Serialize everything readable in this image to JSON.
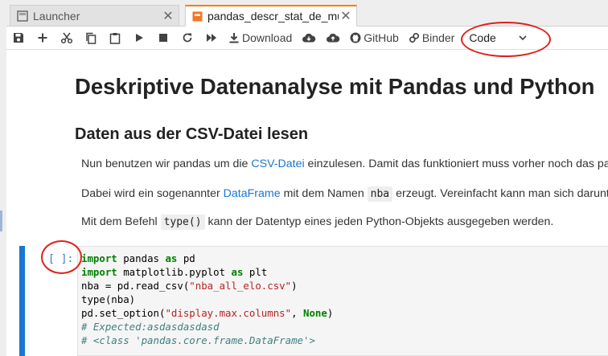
{
  "tabs": [
    {
      "label": "Launcher",
      "close": "✕",
      "icon": "launcher-icon"
    },
    {
      "label": "pandas_descr_stat_de_muste",
      "close": "✕",
      "icon": "notebook-icon",
      "active": true
    }
  ],
  "toolbar": {
    "download_label": "Download",
    "github_label": "GitHub",
    "binder_label": "Binder",
    "cell_type": "Code",
    "icons": [
      "save-icon",
      "add-icon",
      "cut-icon",
      "copy-icon",
      "paste-icon",
      "run-icon",
      "stop-icon",
      "restart-icon",
      "fast-forward-icon",
      "download-icon",
      "cloud-download-icon",
      "cloud-upload-icon",
      "github-icon",
      "binder-icon",
      "chevron-down-icon"
    ]
  },
  "notebook": {
    "title": "Deskriptive Datenanalyse mit Pandas und Python",
    "subtitle": "Daten aus der CSV-Datei lesen",
    "p1": {
      "before": "Nun benutzen wir pandas um die ",
      "link": "CSV-Datei",
      "after": " einzulesen. Damit das funktioniert muss vorher noch das panda"
    },
    "p2": {
      "before": "Dabei wird ein sogenannter ",
      "link": "DataFrame",
      "mid": " mit dem Namen ",
      "code": "nba",
      "after": " erzeugt. Vereinfacht kann man sich darunter"
    },
    "p3": {
      "before": "Mit dem Befehl ",
      "code": "type()",
      "after": " kann der Datentyp eines jeden Python-Objekts ausgegeben werden."
    },
    "cell": {
      "prompt": "[ ]:",
      "lines": [
        "import pandas as pd",
        "import matplotlib.pyplot as plt",
        "nba = pd.read_csv(\"nba_all_elo.csv\")",
        "type(nba)",
        "pd.set_option(\"display.max.columns\", None)",
        "# Expected:asdasdasdasd",
        "# <class 'pandas.core.frame.DataFrame'>"
      ]
    }
  },
  "colors": {
    "accent": "#1976d2",
    "tab_active": "#f57c00",
    "annotation": "#e0201b",
    "keyword": "#008000",
    "comment": "#408080",
    "string": "#ba2121"
  }
}
